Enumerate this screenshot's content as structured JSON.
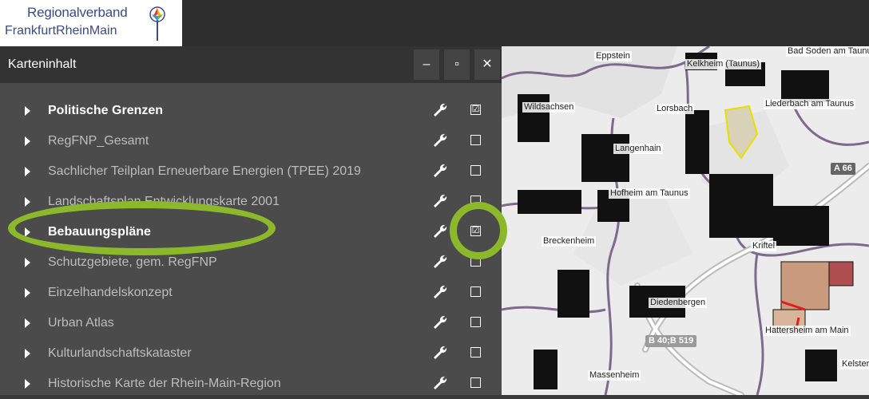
{
  "header": {
    "logo_line1": "Regionalverband",
    "logo_line2": "FrankfurtRheinMain"
  },
  "panel": {
    "title": "Karteninhalt",
    "minimize_label": "–",
    "maximize_label": "▫",
    "close_label": "✕",
    "layers": [
      {
        "label": "Politische Grenzen",
        "checked": true,
        "active": true
      },
      {
        "label": "RegFNP_Gesamt",
        "checked": false,
        "active": false
      },
      {
        "label": "Sachlicher Teilplan Erneuerbare Energien (TPEE) 2019",
        "checked": false,
        "active": false
      },
      {
        "label": "Landschaftsplan Entwicklungskarte 2001",
        "checked": false,
        "active": false
      },
      {
        "label": "Bebauungspläne",
        "checked": true,
        "active": true
      },
      {
        "label": "Schutzgebiete, gem. RegFNP",
        "checked": false,
        "active": false
      },
      {
        "label": "Einzelhandelskonzept",
        "checked": false,
        "active": false
      },
      {
        "label": "Urban Atlas",
        "checked": false,
        "active": false
      },
      {
        "label": "Kulturlandschaftskataster",
        "checked": false,
        "active": false
      },
      {
        "label": "Historische Karte der Rhein-Main-Region",
        "checked": false,
        "active": false
      }
    ],
    "check_mark": "☑",
    "highlight_color": "#8cb92c"
  },
  "map": {
    "labels": {
      "eppstein": "Eppstein",
      "bad_soden": "Bad Soden am Taunus",
      "kelkheim": "Kelkheim (Taunus)",
      "wildsachsen": "Wildsachsen",
      "lorsbach": "Lorsbach",
      "liederbach": "Liederbach am Taunus",
      "langenhain": "Langenhain",
      "hofheim": "Hofheim am Taunus",
      "breckenheim": "Breckenheim",
      "kriftel": "Kriftel",
      "diedenbergen": "Diedenbergen",
      "hattersheim": "Hattersheim am Main",
      "massenheim": "Massenheim",
      "kelsterbach": "Kelster",
      "road_a66": "A 66",
      "road_b519": "B 40;B 519"
    }
  }
}
